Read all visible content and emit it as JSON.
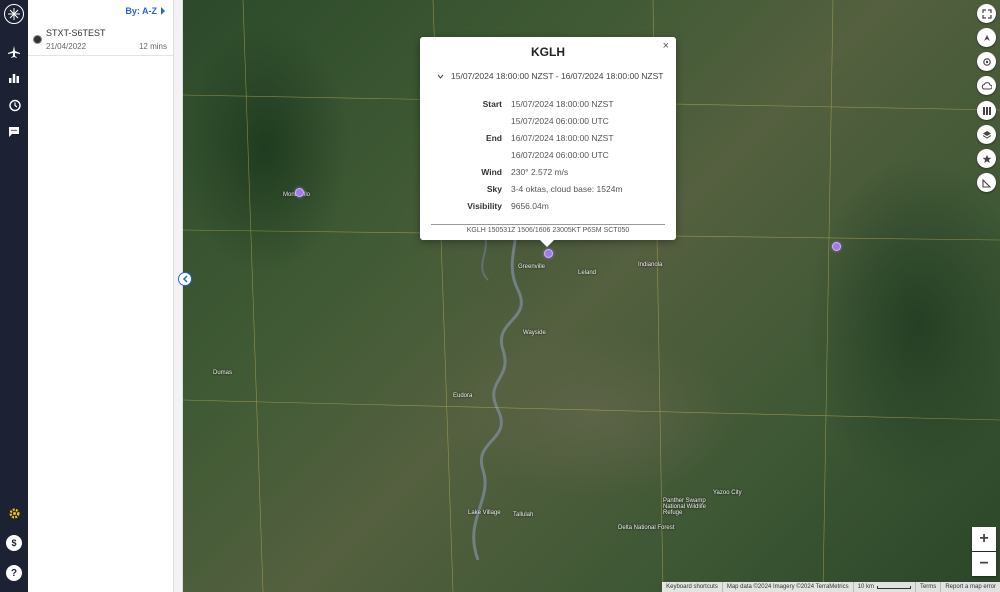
{
  "nav": {
    "icons": [
      "logo-icon",
      "plane-icon",
      "bar-chart-icon",
      "history-icon",
      "chat-icon",
      "gear-icon",
      "dollar-icon",
      "help-icon"
    ],
    "settings_color": "#f2c300",
    "currency_symbol": "$",
    "help_symbol": "?"
  },
  "list": {
    "sort_label": "By: A-Z",
    "items": [
      {
        "name": "STXT-S6TEST",
        "date": "21/04/2022",
        "duration": "12 mins"
      }
    ]
  },
  "popup": {
    "title": "KGLH",
    "close": "×",
    "range": "15/07/2024 18:00:00 NZST - 16/07/2024 18:00:00 NZST",
    "start_label": "Start",
    "start_local": "15/07/2024 18:00:00 NZST",
    "start_utc": "15/07/2024 06:00:00 UTC",
    "end_label": "End",
    "end_local": "16/07/2024 18:00:00 NZST",
    "end_utc": "16/07/2024 06:00:00 UTC",
    "wind_label": "Wind",
    "wind": "230° 2.572 m/s",
    "sky_label": "Sky",
    "sky": "3-4 oktas, cloud base: 1524m",
    "visibility_label": "Visibility",
    "visibility": "9656.04m",
    "raw": "KGLH 150531Z 1506/1606 23005KT P6SM SCT050"
  },
  "map": {
    "marker_color": "#a07be8",
    "place_labels": [
      "Monticello",
      "Greenville",
      "Leland",
      "Indianola",
      "Yazoo City",
      "Eudora",
      "Wayside",
      "Tallulah",
      "Delta National Forest",
      "Panther Swamp National Wildlife Refuge",
      "Lake Village",
      "Dumas"
    ],
    "controls": [
      "fullscreen-icon",
      "compass-icon",
      "locate-icon",
      "cloud-icon",
      "layers-grid-icon",
      "layers-icon",
      "star-icon",
      "measure-icon"
    ],
    "zoom_in": "+",
    "zoom_out": "−"
  },
  "footer": {
    "shortcuts": "Keyboard shortcuts",
    "mapdata": "Map data ©2024 Imagery ©2024 TerraMetrics",
    "scale": "10 km",
    "terms": "Terms",
    "report": "Report a map error"
  }
}
